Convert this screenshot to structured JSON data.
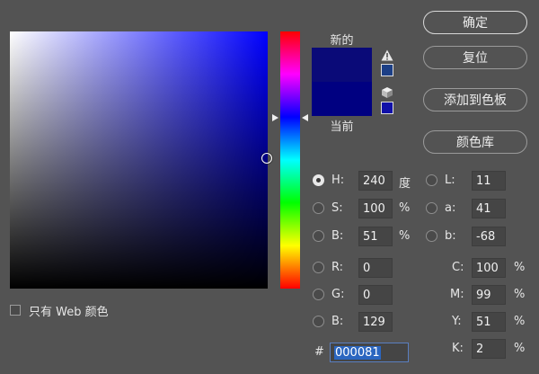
{
  "swatches": {
    "new_label": "新的",
    "current_label": "当前"
  },
  "buttons": {
    "ok": "确定",
    "reset": "复位",
    "add_to_swatches": "添加到色板",
    "color_libraries": "颜色库"
  },
  "hsb": {
    "h_label": "H:",
    "h_value": "240",
    "h_unit": "度",
    "s_label": "S:",
    "s_value": "100",
    "s_unit": "%",
    "b_label": "B:",
    "b_value": "51",
    "b_unit": "%"
  },
  "lab": {
    "l_label": "L:",
    "l_value": "11",
    "a_label": "a:",
    "a_value": "41",
    "b_label": "b:",
    "b_value": "-68"
  },
  "rgb": {
    "r_label": "R:",
    "r_value": "0",
    "g_label": "G:",
    "g_value": "0",
    "b_label": "B:",
    "b_value": "129"
  },
  "cmyk": {
    "c_label": "C:",
    "c_value": "100",
    "c_unit": "%",
    "m_label": "M:",
    "m_value": "99",
    "m_unit": "%",
    "y_label": "Y:",
    "y_value": "51",
    "y_unit": "%",
    "k_label": "K:",
    "k_value": "2",
    "k_unit": "%"
  },
  "hex": {
    "label": "#",
    "value": "000081"
  },
  "web_only": {
    "label": "只有 Web 颜色",
    "checked": false
  },
  "colors": {
    "new_color": "#0a0a78",
    "current_color": "#000081",
    "gamut_warning_swatch": "#1c3f86",
    "web_safe_swatch": "#1010a8"
  },
  "icons": [
    "gamut-warning-icon",
    "web-safe-cube-icon"
  ]
}
